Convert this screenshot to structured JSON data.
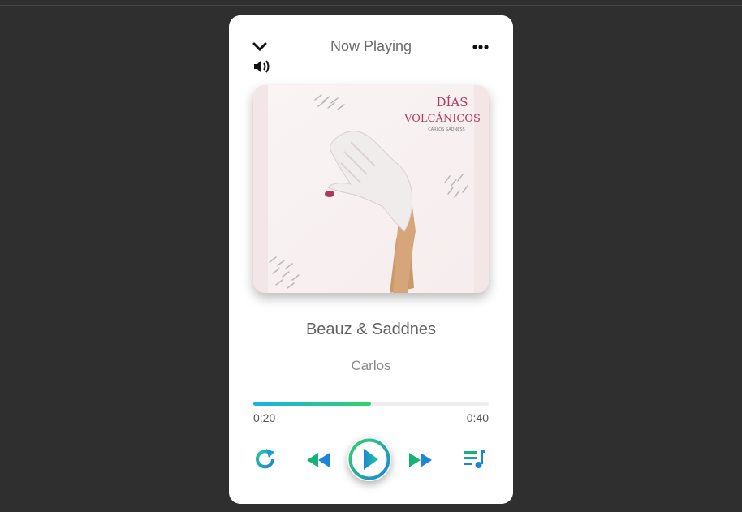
{
  "header": {
    "title": "Now Playing",
    "collapse_icon": "chevron-down-icon",
    "volume_icon": "volume-icon",
    "menu_icon": "more-horizontal-icon"
  },
  "album": {
    "cover_title_line1": "DÍAS",
    "cover_title_line2": "VOLCÁNICOS",
    "cover_artist": "CARLOS SADNESS"
  },
  "track": {
    "song": "Beauz & Saddnes",
    "artist": "Carlos"
  },
  "progress": {
    "current": "0:20",
    "duration": "0:40",
    "fraction": 0.5
  },
  "controls": {
    "repeat_icon": "repeat-icon",
    "prev_icon": "rewind-icon",
    "play_icon": "play-icon",
    "next_icon": "fast-forward-icon",
    "queue_icon": "playlist-icon"
  },
  "colors": {
    "gradient_start": "#1ab0e6",
    "gradient_end": "#2fd36a",
    "control_blue": "#1c86d6",
    "control_green": "#22c99a"
  }
}
